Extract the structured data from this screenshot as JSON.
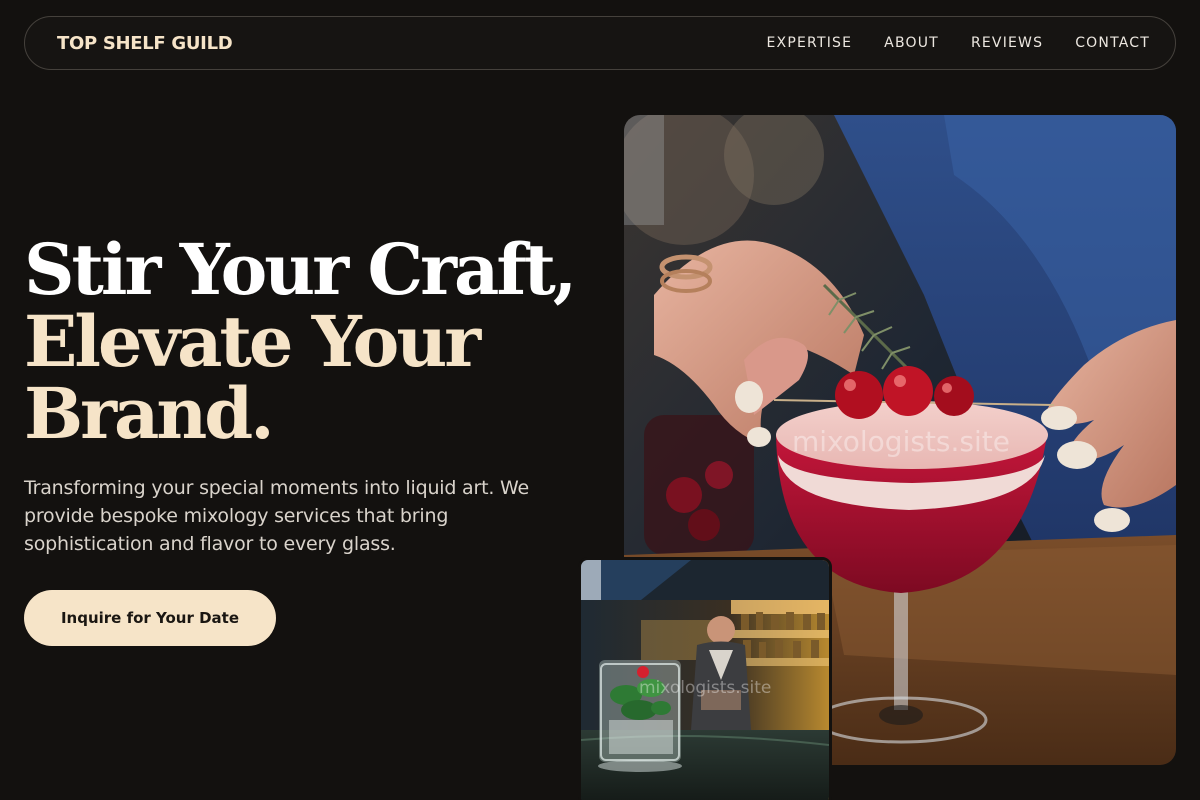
{
  "nav": {
    "brand": "TOP SHELF GUILD",
    "links": [
      {
        "label": "EXPERTISE"
      },
      {
        "label": "ABOUT"
      },
      {
        "label": "REVIEWS"
      },
      {
        "label": "CONTACT"
      }
    ]
  },
  "hero": {
    "title_line1": "Stir Your Craft,",
    "title_line2": "Elevate Your",
    "title_line3": "Brand.",
    "subtitle": "Transforming your special moments into liquid art. We provide bespoke mixology services that bring sophistication and flavor to every glass.",
    "cta_label": "Inquire for Your Date"
  },
  "images": {
    "main_watermark": "mixologists.site",
    "small_watermark": "mixologists.site"
  },
  "colors": {
    "background": "#13110f",
    "accent": "#f6e4c8",
    "text": "#ffffff"
  }
}
